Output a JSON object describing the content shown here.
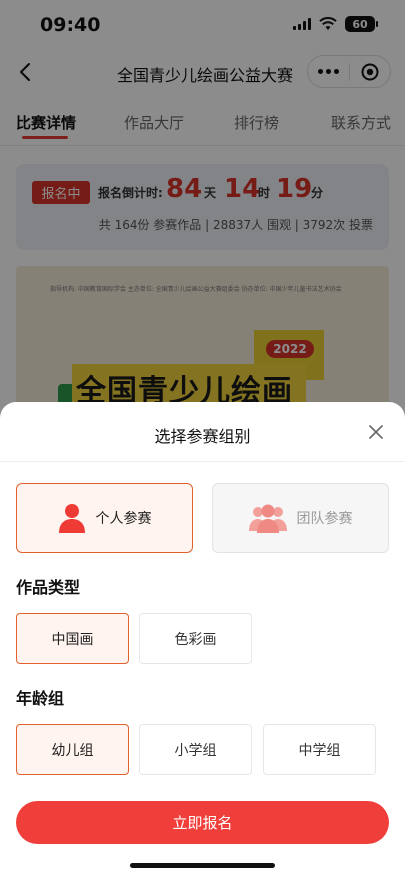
{
  "status_bar": {
    "time": "09:40",
    "battery": "60"
  },
  "nav": {
    "title": "全国青少儿绘画公益大赛"
  },
  "tabs": [
    {
      "label": "比赛详情",
      "active": true
    },
    {
      "label": "作品大厅",
      "active": false
    },
    {
      "label": "排行榜",
      "active": false
    },
    {
      "label": "联系方式",
      "active": false
    }
  ],
  "countdown": {
    "status": "报名中",
    "label": "报名倒计时:",
    "days": "84",
    "days_unit": "天",
    "hours": "14",
    "hours_unit": "时",
    "minutes": "19",
    "minutes_unit": "分",
    "stats": "共 164份 参赛作品 | 28837人 围观 | 3792次 投票"
  },
  "poster": {
    "header_text": "指导机构: 中国教育国际学会    主办单位: 全国青少儿绘画公益大赛组委会    协办单位: 中国少年儿童书法艺术协会",
    "year": "2022",
    "title": "全国青少儿绘画"
  },
  "sheet": {
    "title": "选择参赛组别",
    "participation": [
      {
        "label": "个人参赛",
        "selected": true
      },
      {
        "label": "团队参赛",
        "selected": false
      }
    ],
    "work_type_label": "作品类型",
    "work_types": [
      {
        "label": "中国画",
        "selected": true
      },
      {
        "label": "色彩画",
        "selected": false
      }
    ],
    "age_group_label": "年龄组",
    "age_groups": [
      {
        "label": "幼儿组",
        "selected": true
      },
      {
        "label": "小学组",
        "selected": false
      },
      {
        "label": "中学组",
        "selected": false
      }
    ],
    "submit_label": "立即报名"
  },
  "colors": {
    "accent": "#f03f3b",
    "selected_border": "#e0612e",
    "selected_bg": "#fff4ef"
  }
}
